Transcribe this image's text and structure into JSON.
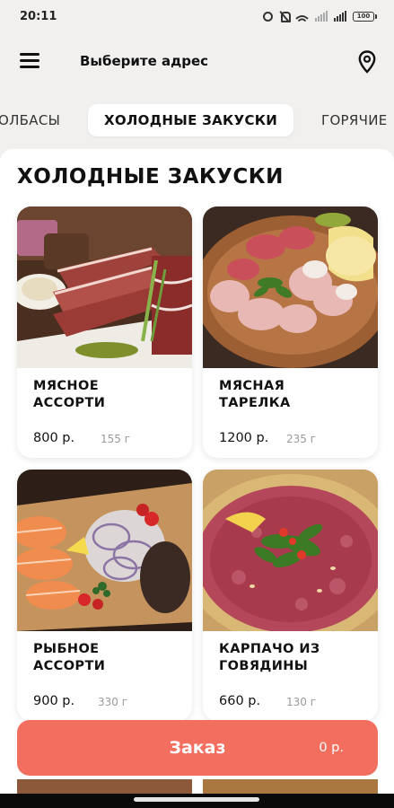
{
  "status_bar": {
    "time": "20:11",
    "battery": "100",
    "icons": [
      "alarm-icon",
      "mute-icon",
      "wifi-icon",
      "signal-icon",
      "signal-icon",
      "battery-icon"
    ]
  },
  "header": {
    "address_label": "Выберите адрес",
    "menu_icon": "menu-icon",
    "location_icon": "location-pin-icon"
  },
  "tabs": [
    {
      "label": "ОЛБАСЫ",
      "active": false
    },
    {
      "label": "ХОЛОДНЫЕ ЗАКУСКИ",
      "active": true
    },
    {
      "label": "ГОРЯЧИЕ",
      "active": false
    }
  ],
  "section": {
    "title": "ХОЛОДНЫЕ ЗАКУСКИ"
  },
  "products": [
    {
      "name": "МЯСНОЕ\nАССОРТИ",
      "price": "800 р.",
      "weight": "155 г"
    },
    {
      "name": "МЯСНАЯ\nТАРЕЛКА",
      "price": "1200 р.",
      "weight": "235 г"
    },
    {
      "name": "РЫБНОЕ\nАССОРТИ",
      "price": "900 р.",
      "weight": "330 г"
    },
    {
      "name": "КАРПАЧО ИЗ\nГОВЯДИНЫ",
      "price": "660 р.",
      "weight": "130 г"
    }
  ],
  "order": {
    "label": "Заказ",
    "total": "0 р."
  },
  "colors": {
    "accent": "#f26e5f",
    "background": "#f1f0ee",
    "card": "#ffffff"
  }
}
